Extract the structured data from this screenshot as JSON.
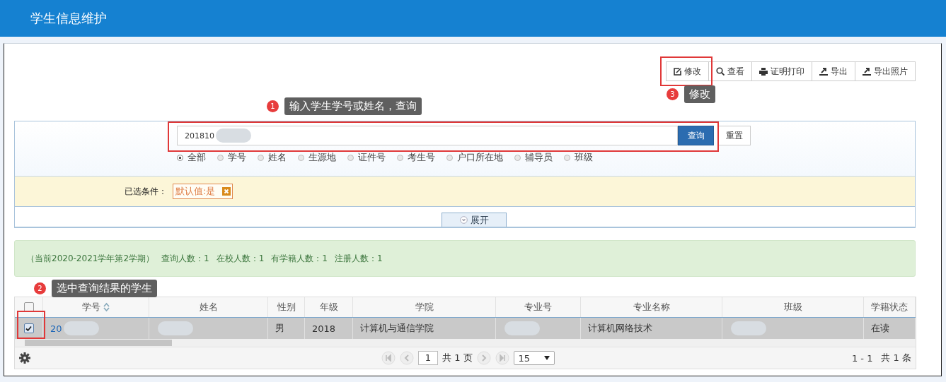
{
  "header": {
    "title": "学生信息维护"
  },
  "toolbar": [
    {
      "label": "修改",
      "kind": "edit"
    },
    {
      "label": "查看",
      "kind": "search"
    },
    {
      "label": "证明打印",
      "kind": "print"
    },
    {
      "label": "导出",
      "kind": "export"
    },
    {
      "label": "导出照片",
      "kind": "export"
    }
  ],
  "callouts": [
    {
      "number": "1",
      "text": "输入学生学号或姓名，查询"
    },
    {
      "number": "2",
      "text": "选中查询结果的学生"
    },
    {
      "number": "3",
      "text": "修改"
    }
  ],
  "search": {
    "value": "201810",
    "redacted": true,
    "button": "查询",
    "reset": "重置",
    "options": [
      {
        "label": "全部",
        "selected": true
      },
      {
        "label": "学号",
        "selected": false
      },
      {
        "label": "姓名",
        "selected": false
      },
      {
        "label": "生源地",
        "selected": false
      },
      {
        "label": "证件号",
        "selected": false
      },
      {
        "label": "考生号",
        "selected": false
      },
      {
        "label": "户口所在地",
        "selected": false
      },
      {
        "label": "辅导员",
        "selected": false
      },
      {
        "label": "班级",
        "selected": false
      }
    ]
  },
  "conditions": {
    "label": "已选条件：",
    "tags": [
      {
        "text": "默认值:是"
      }
    ]
  },
  "expand": {
    "label": "展开"
  },
  "summary": {
    "period": "（当前2020-2021学年第2学期）",
    "stats": [
      "查询人数：1",
      "在校人数：1",
      "有学籍人数：1",
      "注册人数：1"
    ]
  },
  "table": {
    "all_checked": false,
    "columns": [
      {
        "label": "学号",
        "sortable": true
      },
      {
        "label": "姓名",
        "sortable": false
      },
      {
        "label": "性别",
        "sortable": false
      },
      {
        "label": "年级",
        "sortable": false
      },
      {
        "label": "学院",
        "sortable": false
      },
      {
        "label": "专业号",
        "sortable": false
      },
      {
        "label": "专业名称",
        "sortable": false
      },
      {
        "label": "班级",
        "sortable": false
      },
      {
        "label": "学籍状态",
        "sortable": false
      }
    ],
    "rows": [
      {
        "selected": true,
        "checked": true,
        "cells": [
          {
            "text": "20",
            "redacted": true,
            "link": true
          },
          {
            "redacted": true
          },
          {
            "text": "男"
          },
          {
            "text": "2018"
          },
          {
            "text": "计算机与通信学院"
          },
          {
            "redacted": true
          },
          {
            "text": "计算机网络技术"
          },
          {
            "redacted": true
          },
          {
            "text": "在读"
          }
        ]
      }
    ]
  },
  "pager": {
    "page": "1",
    "total_pages": "共 1 页",
    "page_size": "15",
    "range": "1 - 1",
    "total": "共 1 条"
  }
}
